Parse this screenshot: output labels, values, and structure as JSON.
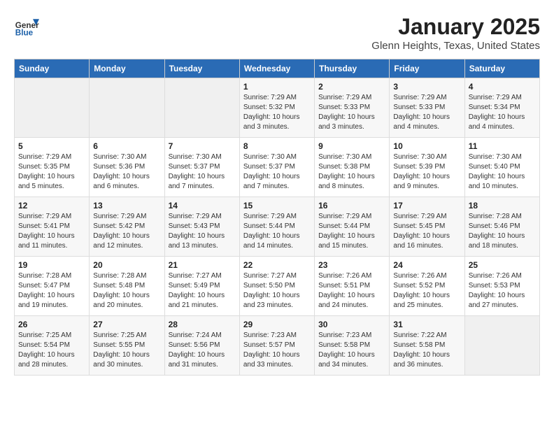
{
  "header": {
    "logo_line1": "General",
    "logo_line2": "Blue",
    "title": "January 2025",
    "subtitle": "Glenn Heights, Texas, United States"
  },
  "days_of_week": [
    "Sunday",
    "Monday",
    "Tuesday",
    "Wednesday",
    "Thursday",
    "Friday",
    "Saturday"
  ],
  "weeks": [
    [
      {
        "day": "",
        "info": ""
      },
      {
        "day": "",
        "info": ""
      },
      {
        "day": "",
        "info": ""
      },
      {
        "day": "1",
        "info": "Sunrise: 7:29 AM\nSunset: 5:32 PM\nDaylight: 10 hours\nand 3 minutes."
      },
      {
        "day": "2",
        "info": "Sunrise: 7:29 AM\nSunset: 5:33 PM\nDaylight: 10 hours\nand 3 minutes."
      },
      {
        "day": "3",
        "info": "Sunrise: 7:29 AM\nSunset: 5:33 PM\nDaylight: 10 hours\nand 4 minutes."
      },
      {
        "day": "4",
        "info": "Sunrise: 7:29 AM\nSunset: 5:34 PM\nDaylight: 10 hours\nand 4 minutes."
      }
    ],
    [
      {
        "day": "5",
        "info": "Sunrise: 7:29 AM\nSunset: 5:35 PM\nDaylight: 10 hours\nand 5 minutes."
      },
      {
        "day": "6",
        "info": "Sunrise: 7:30 AM\nSunset: 5:36 PM\nDaylight: 10 hours\nand 6 minutes."
      },
      {
        "day": "7",
        "info": "Sunrise: 7:30 AM\nSunset: 5:37 PM\nDaylight: 10 hours\nand 7 minutes."
      },
      {
        "day": "8",
        "info": "Sunrise: 7:30 AM\nSunset: 5:37 PM\nDaylight: 10 hours\nand 7 minutes."
      },
      {
        "day": "9",
        "info": "Sunrise: 7:30 AM\nSunset: 5:38 PM\nDaylight: 10 hours\nand 8 minutes."
      },
      {
        "day": "10",
        "info": "Sunrise: 7:30 AM\nSunset: 5:39 PM\nDaylight: 10 hours\nand 9 minutes."
      },
      {
        "day": "11",
        "info": "Sunrise: 7:30 AM\nSunset: 5:40 PM\nDaylight: 10 hours\nand 10 minutes."
      }
    ],
    [
      {
        "day": "12",
        "info": "Sunrise: 7:29 AM\nSunset: 5:41 PM\nDaylight: 10 hours\nand 11 minutes."
      },
      {
        "day": "13",
        "info": "Sunrise: 7:29 AM\nSunset: 5:42 PM\nDaylight: 10 hours\nand 12 minutes."
      },
      {
        "day": "14",
        "info": "Sunrise: 7:29 AM\nSunset: 5:43 PM\nDaylight: 10 hours\nand 13 minutes."
      },
      {
        "day": "15",
        "info": "Sunrise: 7:29 AM\nSunset: 5:44 PM\nDaylight: 10 hours\nand 14 minutes."
      },
      {
        "day": "16",
        "info": "Sunrise: 7:29 AM\nSunset: 5:44 PM\nDaylight: 10 hours\nand 15 minutes."
      },
      {
        "day": "17",
        "info": "Sunrise: 7:29 AM\nSunset: 5:45 PM\nDaylight: 10 hours\nand 16 minutes."
      },
      {
        "day": "18",
        "info": "Sunrise: 7:28 AM\nSunset: 5:46 PM\nDaylight: 10 hours\nand 18 minutes."
      }
    ],
    [
      {
        "day": "19",
        "info": "Sunrise: 7:28 AM\nSunset: 5:47 PM\nDaylight: 10 hours\nand 19 minutes."
      },
      {
        "day": "20",
        "info": "Sunrise: 7:28 AM\nSunset: 5:48 PM\nDaylight: 10 hours\nand 20 minutes."
      },
      {
        "day": "21",
        "info": "Sunrise: 7:27 AM\nSunset: 5:49 PM\nDaylight: 10 hours\nand 21 minutes."
      },
      {
        "day": "22",
        "info": "Sunrise: 7:27 AM\nSunset: 5:50 PM\nDaylight: 10 hours\nand 23 minutes."
      },
      {
        "day": "23",
        "info": "Sunrise: 7:26 AM\nSunset: 5:51 PM\nDaylight: 10 hours\nand 24 minutes."
      },
      {
        "day": "24",
        "info": "Sunrise: 7:26 AM\nSunset: 5:52 PM\nDaylight: 10 hours\nand 25 minutes."
      },
      {
        "day": "25",
        "info": "Sunrise: 7:26 AM\nSunset: 5:53 PM\nDaylight: 10 hours\nand 27 minutes."
      }
    ],
    [
      {
        "day": "26",
        "info": "Sunrise: 7:25 AM\nSunset: 5:54 PM\nDaylight: 10 hours\nand 28 minutes."
      },
      {
        "day": "27",
        "info": "Sunrise: 7:25 AM\nSunset: 5:55 PM\nDaylight: 10 hours\nand 30 minutes."
      },
      {
        "day": "28",
        "info": "Sunrise: 7:24 AM\nSunset: 5:56 PM\nDaylight: 10 hours\nand 31 minutes."
      },
      {
        "day": "29",
        "info": "Sunrise: 7:23 AM\nSunset: 5:57 PM\nDaylight: 10 hours\nand 33 minutes."
      },
      {
        "day": "30",
        "info": "Sunrise: 7:23 AM\nSunset: 5:58 PM\nDaylight: 10 hours\nand 34 minutes."
      },
      {
        "day": "31",
        "info": "Sunrise: 7:22 AM\nSunset: 5:58 PM\nDaylight: 10 hours\nand 36 minutes."
      },
      {
        "day": "",
        "info": ""
      }
    ]
  ]
}
